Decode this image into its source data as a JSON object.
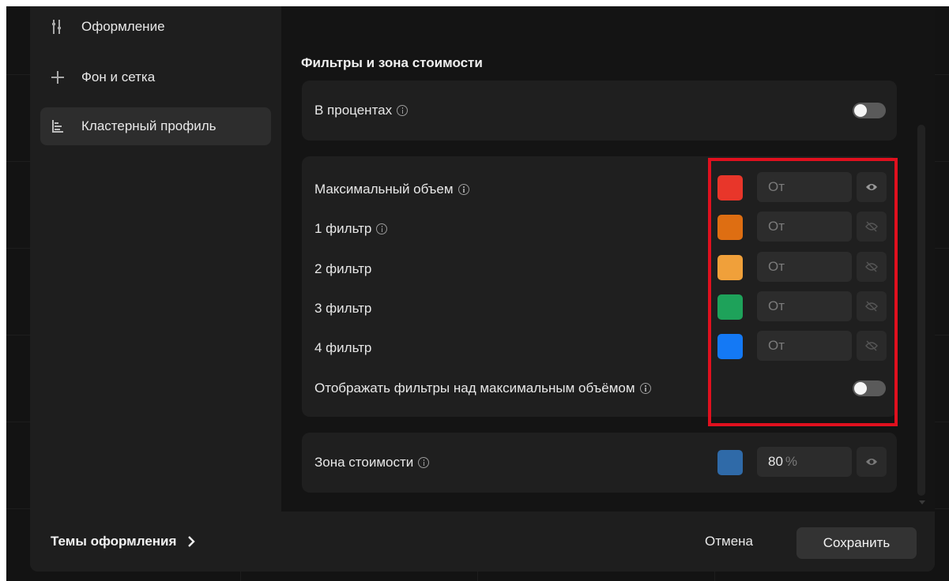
{
  "sidebar": {
    "items": [
      {
        "label": "Оформление",
        "icon": "sliders-icon"
      },
      {
        "label": "Фон и сетка",
        "icon": "plus-icon"
      },
      {
        "label": "Кластерный профиль",
        "icon": "cluster-profile-icon",
        "active": true
      }
    ]
  },
  "section": {
    "title": "Фильтры и зона стоимости"
  },
  "percent_row": {
    "label": "В процентах",
    "toggle_on": false
  },
  "filters": {
    "rows": [
      {
        "label": "Максимальный объем",
        "has_info": true,
        "color": "#e8362a",
        "placeholder": "От",
        "visible": true
      },
      {
        "label": "1 фильтр",
        "has_info": true,
        "color": "#de6e12",
        "placeholder": "От",
        "visible": false
      },
      {
        "label": "2 фильтр",
        "has_info": false,
        "color": "#f0a03a",
        "placeholder": "От",
        "visible": false
      },
      {
        "label": "3 фильтр",
        "has_info": false,
        "color": "#1ea25a",
        "placeholder": "От",
        "visible": false
      },
      {
        "label": "4 фильтр",
        "has_info": false,
        "color": "#1479f5",
        "placeholder": "От",
        "visible": false
      }
    ],
    "show_above_label": "Отображать фильтры над максимальным объёмом",
    "show_above_toggle_on": false
  },
  "value_zone": {
    "label": "Зона стоимости",
    "color": "#2f6aa8",
    "value": "80",
    "unit": "%",
    "visible": true
  },
  "footer": {
    "themes_label": "Темы оформления",
    "cancel_label": "Отмена",
    "save_label": "Сохранить"
  },
  "colors": {
    "highlight_border": "#e0101e"
  }
}
